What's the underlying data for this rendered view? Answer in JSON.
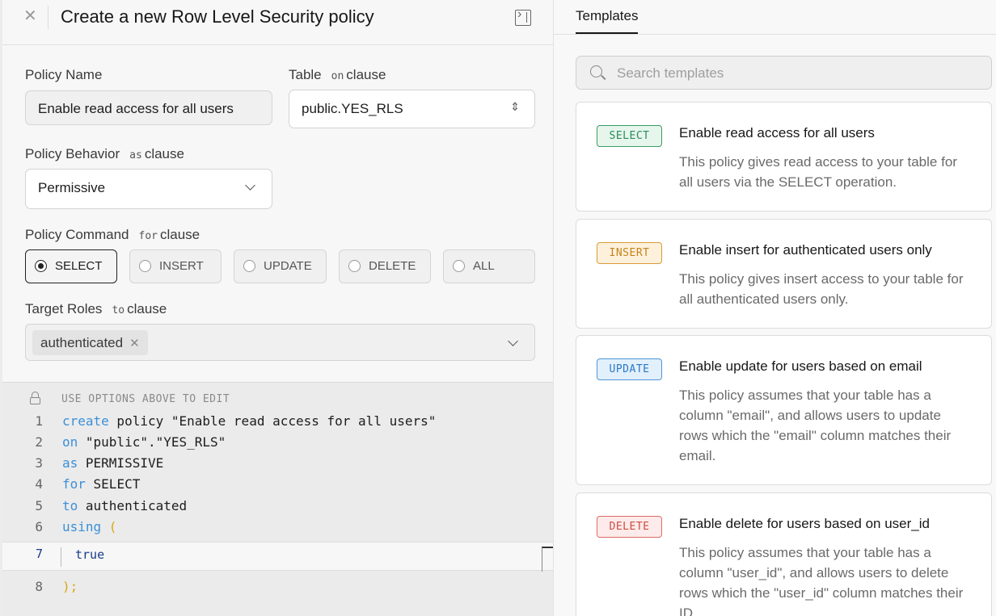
{
  "header": {
    "title": "Create a new Row Level Security policy"
  },
  "form": {
    "policy_name": {
      "label": "Policy Name",
      "value": "Enable read access for all users"
    },
    "table": {
      "label": "Table",
      "clause_keyword": "on",
      "clause_word": "clause",
      "value": "public.YES_RLS"
    },
    "behavior": {
      "label": "Policy Behavior",
      "clause_keyword": "as",
      "clause_word": "clause",
      "value": "Permissive"
    },
    "command": {
      "label": "Policy Command",
      "clause_keyword": "for",
      "clause_word": "clause",
      "options": [
        "SELECT",
        "INSERT",
        "UPDATE",
        "DELETE",
        "ALL"
      ],
      "selected": "SELECT"
    },
    "roles": {
      "label": "Target Roles",
      "clause_keyword": "to",
      "clause_word": "clause",
      "chips": [
        "authenticated"
      ]
    }
  },
  "editor": {
    "hint": "USE OPTIONS ABOVE TO EDIT",
    "lines": [
      {
        "num": "1",
        "kw": "create",
        "rest": " policy \"Enable read access for all users\""
      },
      {
        "num": "2",
        "kw": "on",
        "rest": " \"public\".\"YES_RLS\""
      },
      {
        "num": "3",
        "kw": "as",
        "rest": " PERMISSIVE"
      },
      {
        "num": "4",
        "kw": "for",
        "rest": " SELECT"
      },
      {
        "num": "5",
        "kw": "to",
        "rest": " authenticated"
      },
      {
        "num": "6",
        "kw": "using",
        "rest": " ("
      },
      {
        "num": "7",
        "kw": "",
        "rest": "true"
      },
      {
        "num": "8",
        "kw": "",
        "rest": ");"
      }
    ]
  },
  "templates": {
    "tab_label": "Templates",
    "search_placeholder": "Search templates",
    "cards": [
      {
        "badge": "SELECT",
        "title": "Enable read access for all users",
        "desc": "This policy gives read access to your table for all users via the SELECT operation."
      },
      {
        "badge": "INSERT",
        "title": "Enable insert for authenticated users only",
        "desc": "This policy gives insert access to your table for all authenticated users only."
      },
      {
        "badge": "UPDATE",
        "title": "Enable update for users based on email",
        "desc": "This policy assumes that your table has a column \"email\", and allows users to update rows which the \"email\" column matches their email."
      },
      {
        "badge": "DELETE",
        "title": "Enable delete for users based on user_id",
        "desc": "This policy assumes that your table has a column \"user_id\", and allows users to delete rows which the \"user_id\" column matches their ID"
      }
    ]
  }
}
